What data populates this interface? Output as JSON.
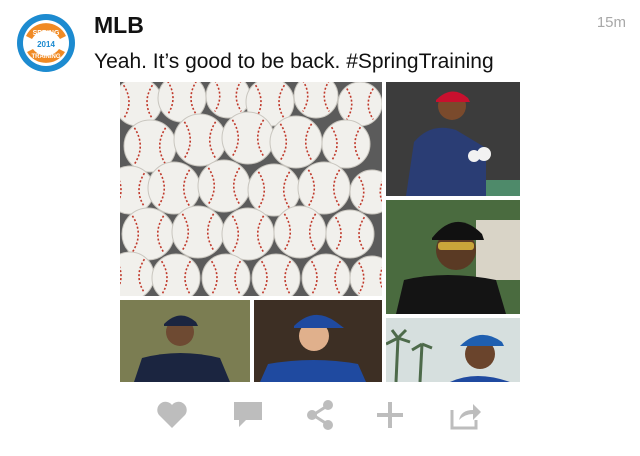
{
  "post": {
    "author": "MLB",
    "time": "15m",
    "text": "Yeah. It’s good to be back. #SpringTraining"
  },
  "avatar": {
    "badge_top": "SPRING",
    "badge_year": "2014",
    "badge_bottom": "TRAINING"
  },
  "photos": [
    {
      "name": "baseballs-photo",
      "subject": "pile of baseballs"
    },
    {
      "name": "player-twins-photo",
      "subject": "player in red cap holding baseballs"
    },
    {
      "name": "player-pirates-photo",
      "subject": "player in black cap with sunglasses"
    },
    {
      "name": "player-yankees-photo",
      "subject": "player in navy cap and jersey"
    },
    {
      "name": "player-bluejays-photo",
      "subject": "player in blue cap smiling"
    },
    {
      "name": "player-marlins-photo",
      "subject": "player in blue cap with palm trees"
    }
  ],
  "actions": [
    {
      "name": "like-button",
      "icon": "heart-icon"
    },
    {
      "name": "reply-button",
      "icon": "speech-bubble-icon"
    },
    {
      "name": "share-button",
      "icon": "share-nodes-icon"
    },
    {
      "name": "add-button",
      "icon": "plus-icon"
    },
    {
      "name": "export-button",
      "icon": "export-arrow-icon"
    }
  ],
  "colors": {
    "icon_gray": "#bdbdbd",
    "text": "#111111",
    "timestamp": "#a8a8a8",
    "badge_blue": "#1d8bd0",
    "badge_orange": "#f08a24"
  }
}
